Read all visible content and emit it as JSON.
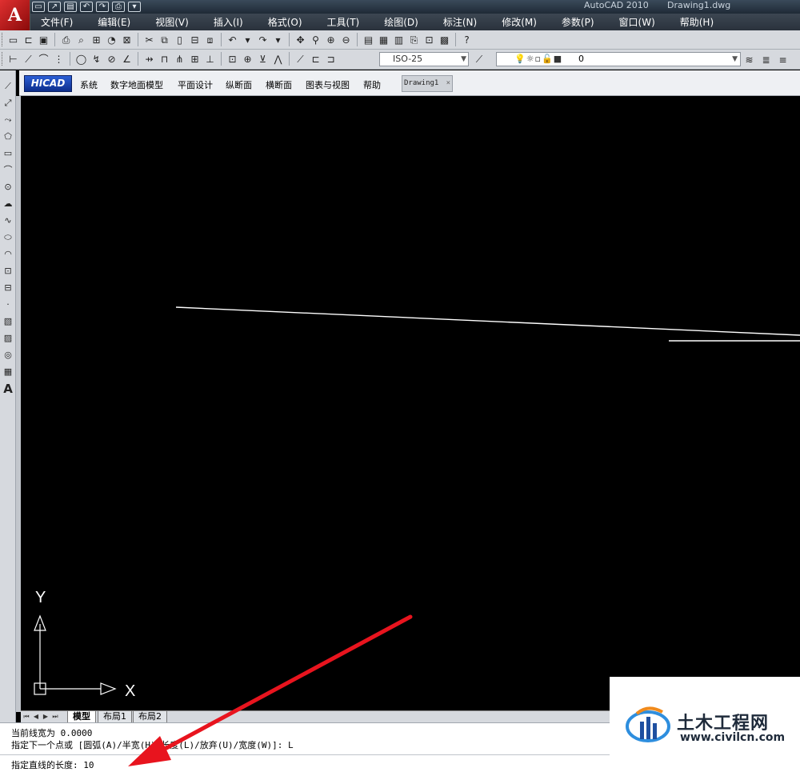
{
  "window": {
    "app_title": "AutoCAD 2010",
    "document_title": "Drawing1.dwg",
    "app_logo_letter": "A",
    "quick_access": [
      "new-icon",
      "open-icon",
      "save-icon",
      "undo-icon",
      "redo-icon",
      "plot-icon",
      "dropdown-icon"
    ]
  },
  "menubar": {
    "items": [
      "文件(F)",
      "编辑(E)",
      "视图(V)",
      "插入(I)",
      "格式(O)",
      "工具(T)",
      "绘图(D)",
      "标注(N)",
      "修改(M)",
      "参数(P)",
      "窗口(W)",
      "帮助(H)"
    ]
  },
  "toolbar_dim": {
    "dimstyle_value": "ISO-25",
    "layer_value": "0"
  },
  "plugin_bar": {
    "logo_text": "HICAD",
    "items": [
      "系统",
      "数字地面模型",
      "平面设计",
      "纵断面",
      "横断面",
      "图表与视图",
      "帮助"
    ],
    "doc_tab": "Drawing1",
    "doc_tab_close": "×"
  },
  "ucs": {
    "y_label": "Y",
    "x_label": "X"
  },
  "layout_tabs": {
    "model": "模型",
    "layout1": "布局1",
    "layout2": "布局2"
  },
  "command": {
    "line1": "当前线宽为 0.0000",
    "line2": "指定下一个点或 [圆弧(A)/半宽(H)/长度(L)/放弃(U)/宽度(W)]: L",
    "line3": "指定直线的长度: 10"
  },
  "watermark": {
    "title": "土木工程网",
    "url": "www.civilcn.com"
  },
  "colors": {
    "canvas": "#000000",
    "annotation_arrow": "#e8141e",
    "menubar": "#2e3742"
  }
}
